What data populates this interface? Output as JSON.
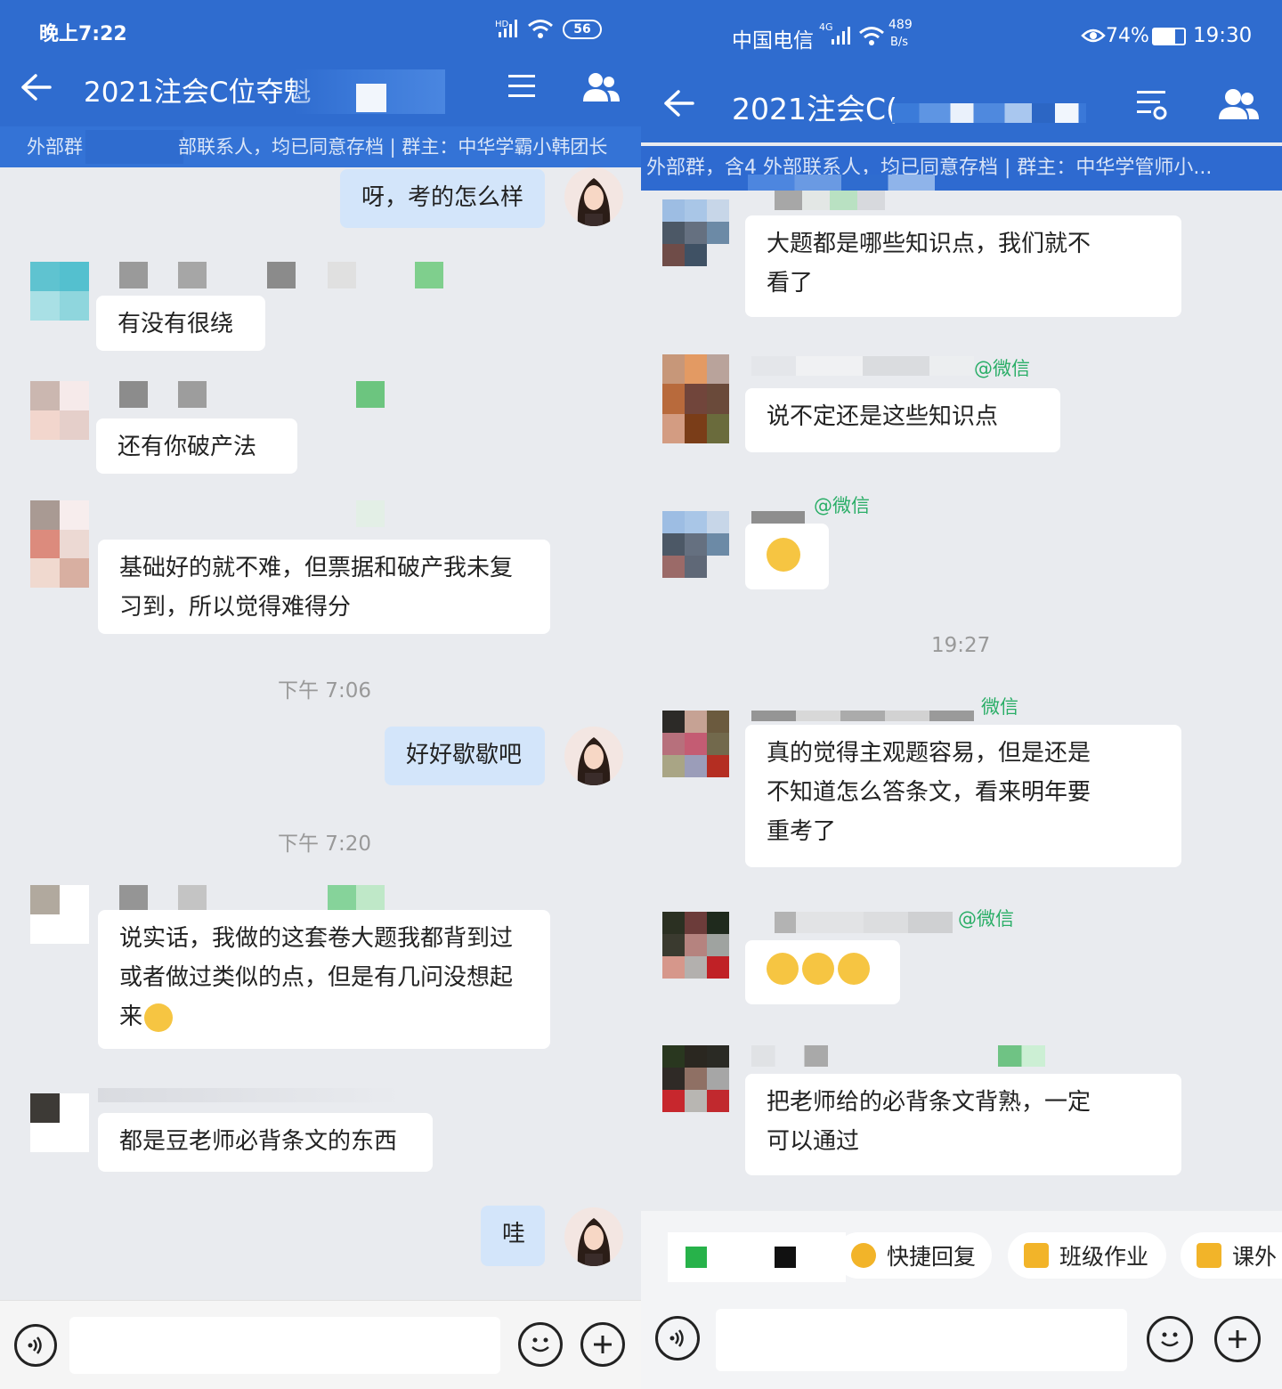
{
  "left": {
    "status": {
      "time": "晚上7:22",
      "hd": "HD",
      "battery": "56"
    },
    "header": {
      "title": "2021注会C位夺魁"
    },
    "subbar": {
      "prefix": "外部群",
      "text": "部联系人，均已同意存档 | 群主：中华学霸小韩团长"
    },
    "messages": {
      "m1": "呀，考的怎么样",
      "m2": "有没有很绕",
      "m3": "还有你破产法",
      "m4": [
        "基础好的就不难，但票据和破产我未复",
        "习到，所以觉得难得分"
      ],
      "t1": "下午 7:06",
      "m5": "好好歇歇吧",
      "t2": "下午 7:20",
      "m6": [
        "说实话，我做的这套卷大题我都背到过",
        "或者做过类似的点，但是有几问没想起",
        "来"
      ],
      "m7": "都是豆老师必背条文的东西",
      "m8": "哇"
    }
  },
  "right": {
    "status": {
      "carrier": "中国电信",
      "net": "4G",
      "speed": "489",
      "speed_unit": "B/s",
      "battery": "74%",
      "time": "19:30"
    },
    "header": {
      "title": "2021注会C("
    },
    "subbar": {
      "text": "外部群，含4    外部联系人，均已同意存档 | 群主：中华学管师小..."
    },
    "messages": {
      "m1": [
        "大题都是哪些知识点，我们就不",
        "看了"
      ],
      "w1": "@微信",
      "m2": "说不定还是这些知识点",
      "w2": "@微信",
      "t1": "19:27",
      "w3": "微信",
      "m3": [
        "真的觉得主观题容易，但是还是",
        "不知道怎么答条文，看来明年要",
        "重考了"
      ],
      "w4": "@微信",
      "m4": "把老师给的必背条文背熟，一定",
      "m4b": "可以通过"
    },
    "chips": [
      "快捷回复",
      "班级作业",
      "课外"
    ]
  }
}
